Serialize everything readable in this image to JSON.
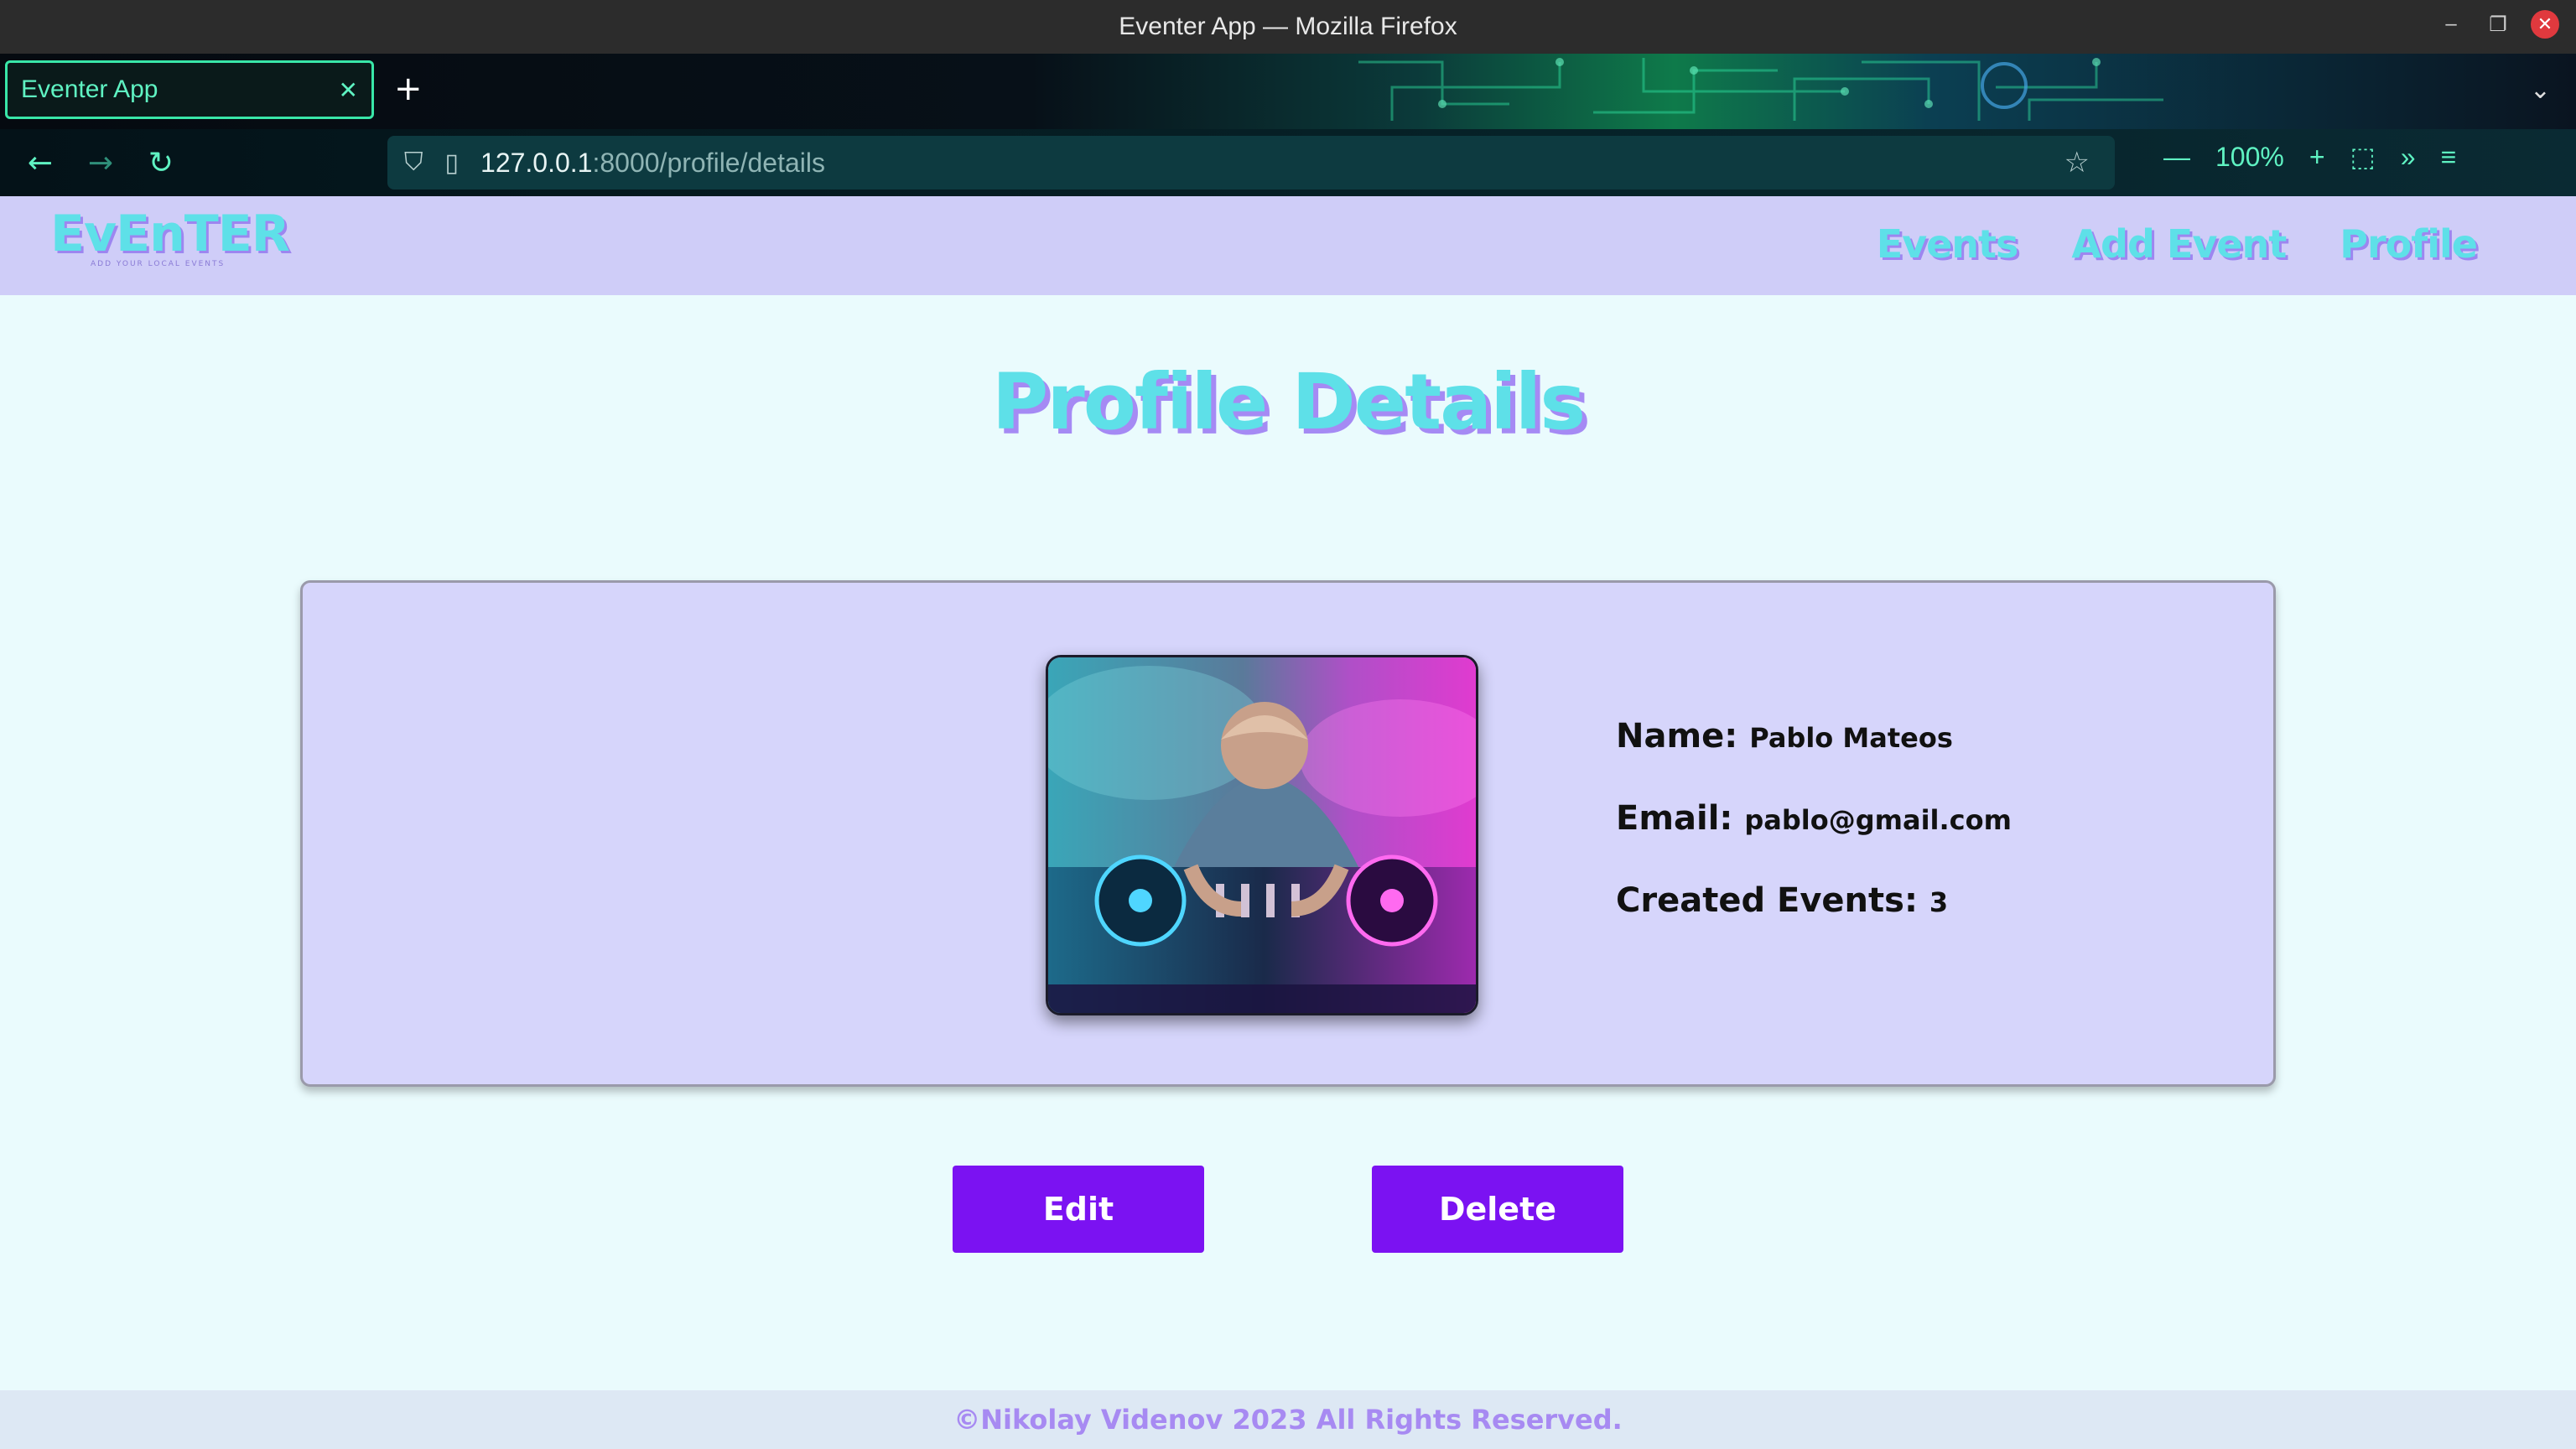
{
  "window": {
    "title": "Eventer App — Mozilla Firefox"
  },
  "tabs": [
    {
      "label": "Eventer App",
      "active": true
    }
  ],
  "browser": {
    "url_host": "127.0.0.1",
    "url_path": ":8000/profile/details",
    "zoom": "100%"
  },
  "site": {
    "logo_text": "EvEnTER",
    "logo_tagline": "ADD YOUR LOCAL EVENTS",
    "nav": [
      "Events",
      "Add Event",
      "Profile"
    ]
  },
  "page": {
    "title": "Profile Details",
    "profile": {
      "name_label": "Name:",
      "name_value": "Pablo Mateos",
      "email_label": "Email:",
      "email_value": "pablo@gmail.com",
      "events_label": "Created Events:",
      "events_value": "3"
    },
    "buttons": {
      "edit": "Edit",
      "delete": "Delete"
    },
    "footer": "©Nikolay Videnov 2023 All Rights Reserved."
  },
  "colors": {
    "header_bg": "#cfcdf8",
    "page_bg": "#eafbfd",
    "accent_cyan": "#5ee0e8",
    "accent_purple": "#a58af4",
    "button_bg": "#7b12f2"
  }
}
